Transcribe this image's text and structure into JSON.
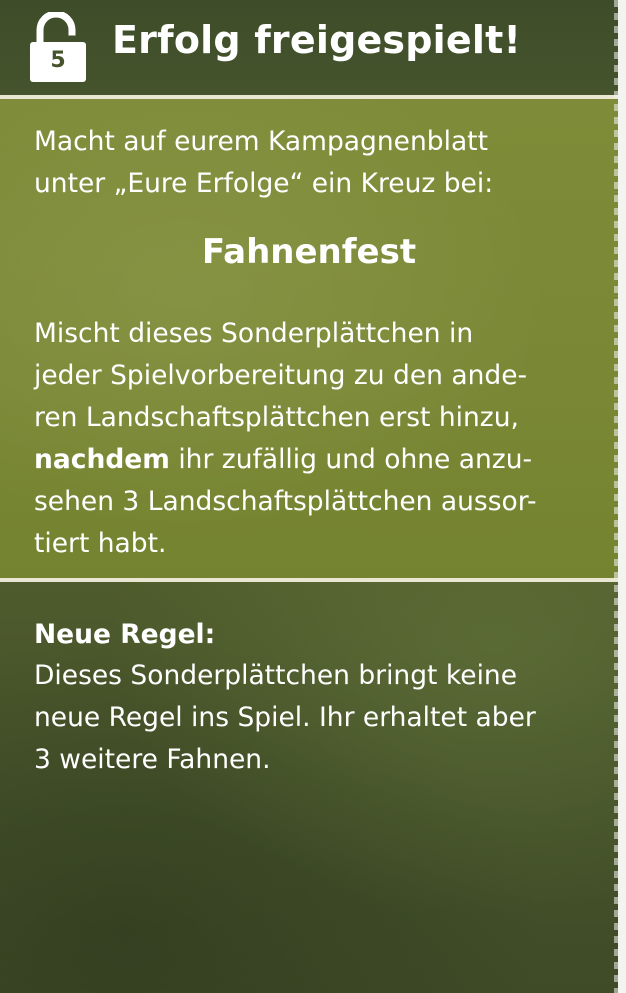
{
  "header": {
    "lock_number": "5",
    "title": "Erfolg freigespielt!"
  },
  "intro": {
    "lines": [
      "Macht auf eurem Kampagnenblatt",
      "unter „Eure Erfolge“ ein Kreuz bei:"
    ]
  },
  "achievement_name": "Fahnenfest",
  "instructions": {
    "line1": "Mischt dieses Sonderplättchen in",
    "line2": "jeder Spielvorbereitung zu den ande-",
    "line3": "ren Landschaftsplättchen erst hinzu,",
    "line4_bold": "nachdem",
    "line4_rest": " ihr zufällig und ohne anzu-",
    "line5": "sehen 3 Landschaftsplättchen aussor-",
    "line6": "tiert habt."
  },
  "new_rule": {
    "heading": "Neue Regel:",
    "lines": [
      "Dieses Sonderplättchen bringt keine",
      "neue Regel ins Spiel. Ihr erhaltet aber",
      "3 weitere Fahnen."
    ]
  },
  "colors": {
    "header_bg": "#46542d",
    "olive_section": "#7e8c39",
    "dark_section": "#45522a",
    "divider": "#e9e7d2",
    "text": "#ffffff"
  },
  "icons": {
    "lock": "open-padlock-icon"
  }
}
